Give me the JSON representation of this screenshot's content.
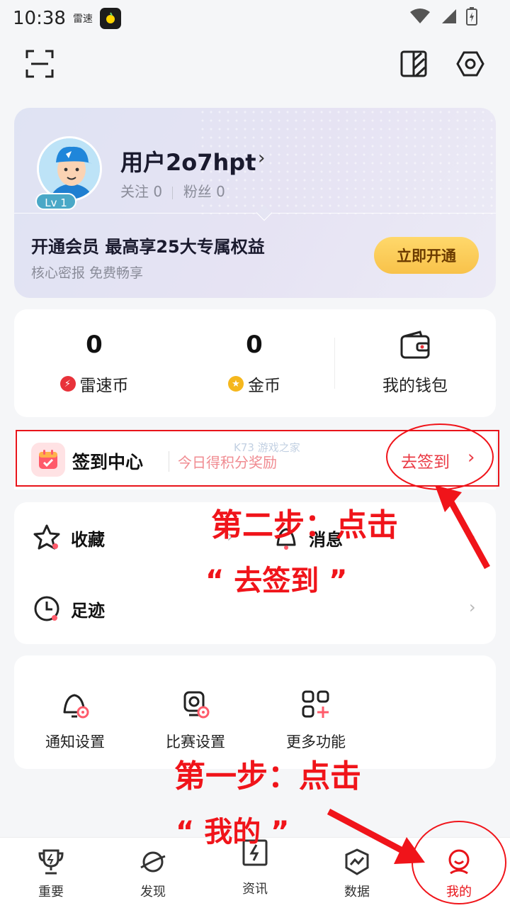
{
  "status_bar": {
    "time": "10:38",
    "carrier": "雷速"
  },
  "profile": {
    "level": "Lv 1",
    "username": "用户2o7hpt",
    "follow_label": "关注",
    "follow_count": "0",
    "fans_label": "粉丝",
    "fans_count": "0",
    "vip_title": "开通会员 最高享25大专属权益",
    "vip_subtitle": "核心密报 免费畅享",
    "vip_button": "立即开通"
  },
  "wallet": {
    "leisu_coin_value": "0",
    "leisu_coin_label": "雷速币",
    "gold_coin_value": "0",
    "gold_coin_label": "金币",
    "wallet_label": "我的钱包"
  },
  "signin": {
    "title": "签到中心",
    "subtitle": "今日得积分奖励",
    "action": "去签到"
  },
  "menu": {
    "favorites": "收藏",
    "messages": "消息",
    "footprints": "足迹"
  },
  "functions": [
    {
      "label": "通知设置",
      "icon": "bell-settings-icon"
    },
    {
      "label": "比赛设置",
      "icon": "match-settings-icon"
    },
    {
      "label": "更多功能",
      "icon": "more-functions-icon"
    }
  ],
  "tabs": [
    {
      "label": "重要",
      "icon": "trophy-icon"
    },
    {
      "label": "发现",
      "icon": "planet-icon"
    },
    {
      "label": "资讯",
      "icon": "news-icon"
    },
    {
      "label": "数据",
      "icon": "data-icon"
    },
    {
      "label": "我的",
      "icon": "profile-icon",
      "active": true
    }
  ],
  "annotations": {
    "step2_line1": "第二步：点击",
    "step2_line2": "“ 去签到 ”",
    "step1_line1": "第一步：点击",
    "step1_line2": "“ 我的 ”"
  },
  "watermark": "K73 游戏之家",
  "colors": {
    "accent": "#e8141a",
    "vip_gold": "#f8c24a",
    "page_bg": "#f5f6f8"
  }
}
